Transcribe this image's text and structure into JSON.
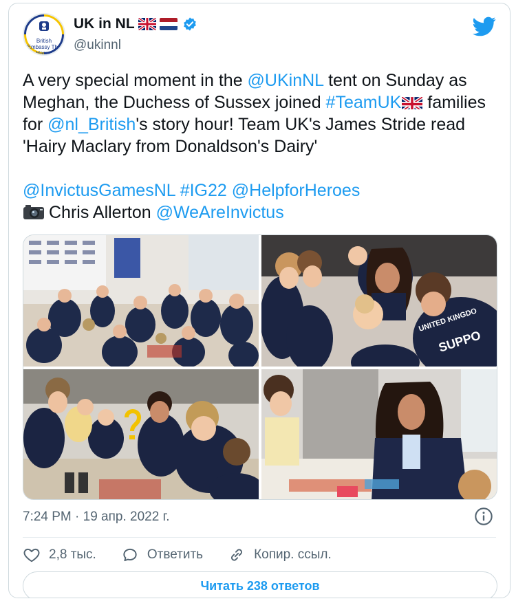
{
  "author": {
    "name": "UK in NL",
    "handle": "@ukinnl",
    "avatar_label": "British Embassy The Hague",
    "verified": true,
    "flag_icons": [
      "uk-flag-icon",
      "nl-flag-icon"
    ]
  },
  "tweet": {
    "line1_pre": "A very special moment in the ",
    "mention_ukinnl": "@UKinNL",
    "line1_post": " tent on Sunday as Meghan, the Duchess of Sussex joined ",
    "hashtag_teamuk": "#TeamUK",
    "line2_pre": " families for ",
    "mention_nl_british": "@nl_British",
    "line2_post": "'s story hour! Team UK's James Stride read 'Hairy Maclary from Donaldson's Dairy'",
    "mention_invictus": "@InvictusGamesNL",
    "hashtag_ig22": "#IG22",
    "mention_helpforheroes": "@HelpforHeroes",
    "photo_credit": "Chris Allerton",
    "mention_weareinvictus": "@WeAreInvictus"
  },
  "meta": {
    "timestamp": "7:24 PM · 19 апр. 2022 г."
  },
  "actions": {
    "like_count": "2,8 тыс.",
    "reply_label": "Ответить",
    "copy_label": "Копир. ссыл."
  },
  "replies_button": "Читать 238 ответов",
  "colors": {
    "link": "#1d9bf0",
    "text": "#0f1419",
    "secondary": "#536471",
    "border": "#cfd9de"
  }
}
